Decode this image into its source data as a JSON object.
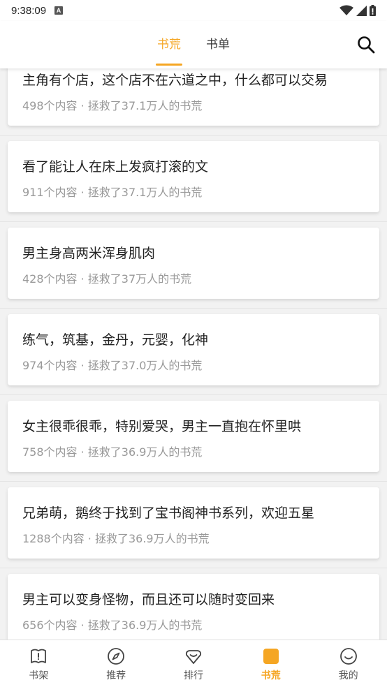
{
  "status_bar": {
    "time": "9:38:09",
    "badge": "A"
  },
  "header": {
    "tabs": [
      {
        "label": "书荒",
        "active": true
      },
      {
        "label": "书单",
        "active": false
      }
    ]
  },
  "colors": {
    "accent": "#f5a623",
    "text": "#222222",
    "sub_text": "#999999"
  },
  "cards": [
    {
      "title": "主角有个店，这个店不在六道之中，什么都可以交易",
      "meta": "498个内容 · 拯救了37.1万人的书荒"
    },
    {
      "title": "看了能让人在床上发疯打滚的文",
      "meta": "911个内容 · 拯救了37.1万人的书荒"
    },
    {
      "title": "男主身高两米浑身肌肉",
      "meta": "428个内容 · 拯救了37万人的书荒"
    },
    {
      "title": "练气，筑基，金丹，元婴，化神",
      "meta": "974个内容 · 拯救了37.0万人的书荒"
    },
    {
      "title": "女主很乖很乖，特别爱哭，男主一直抱在怀里哄",
      "meta": "758个内容 · 拯救了36.9万人的书荒"
    },
    {
      "title": "兄弟萌，鹅终于找到了宝书阁神书系列，欢迎五星",
      "meta": "1288个内容 · 拯救了36.9万人的书荒"
    },
    {
      "title": "男主可以变身怪物，而且还可以随时变回来",
      "meta": "656个内容 · 拯救了36.9万人的书荒"
    }
  ],
  "bottom_nav": [
    {
      "label": "书架",
      "icon": "bookshelf-icon",
      "active": false
    },
    {
      "label": "推荐",
      "icon": "compass-icon",
      "active": false
    },
    {
      "label": "排行",
      "icon": "ranking-icon",
      "active": false
    },
    {
      "label": "书荒",
      "icon": "book-shortage-icon",
      "active": true
    },
    {
      "label": "我的",
      "icon": "profile-icon",
      "active": false
    }
  ]
}
